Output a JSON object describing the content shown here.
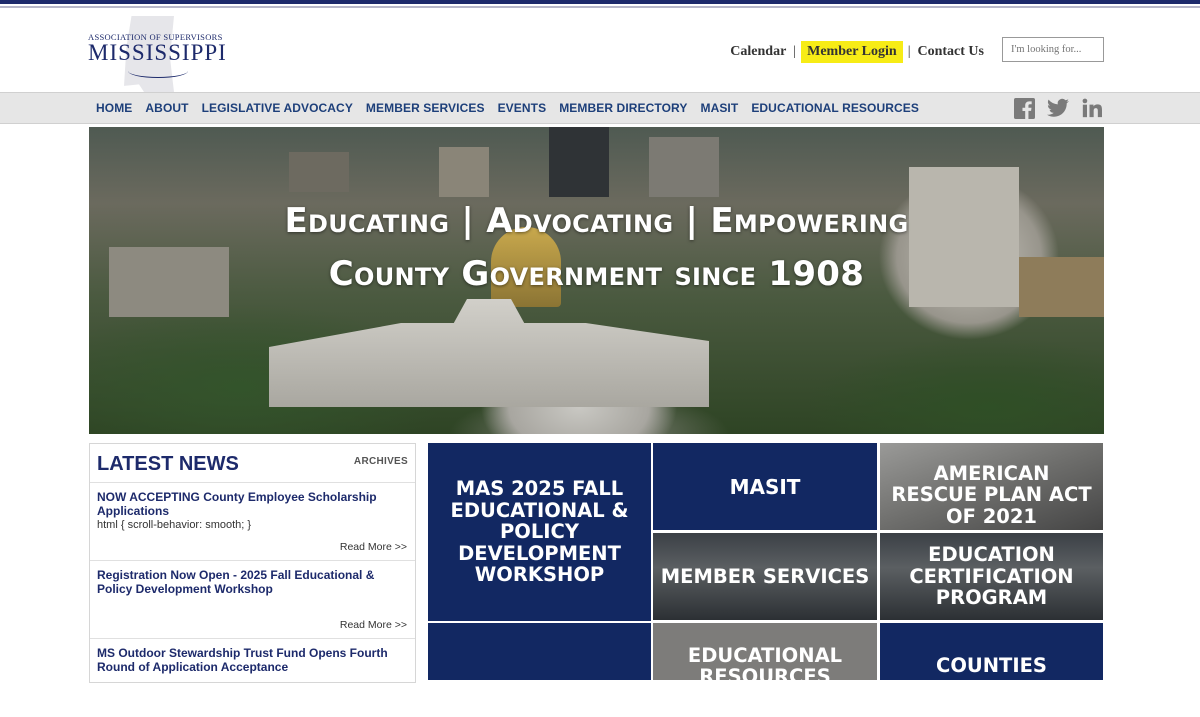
{
  "header": {
    "logo": {
      "assoc_text": "ASSOCIATION OF SUPERVISORS",
      "state_text": "MISSISSIPPI"
    },
    "links": {
      "calendar": "Calendar",
      "sep": "|",
      "member_login": "Member Login",
      "contact": "Contact Us"
    },
    "search_placeholder": "I'm looking for...",
    "highlight_color": "#f7ec16"
  },
  "nav": {
    "items": [
      "HOME",
      "ABOUT",
      "LEGISLATIVE ADVOCACY",
      "MEMBER SERVICES",
      "EVENTS",
      "MEMBER DIRECTORY",
      "MASIT",
      "EDUCATIONAL RESOURCES"
    ],
    "social": [
      "facebook-icon",
      "twitter-icon",
      "linkedin-icon"
    ]
  },
  "hero": {
    "line1": "Educating | Advocating | Empowering",
    "line2": "County Government since 1908"
  },
  "news": {
    "title": "LATEST NEWS",
    "archives": "ARCHIVES",
    "read_more": "Read More >>",
    "items": [
      {
        "title": "NOW ACCEPTING County Employee Scholarship Applications",
        "snippet": "html { scroll-behavior: smooth; }"
      },
      {
        "title": "Registration Now Open - 2025 Fall Educational & Policy Development Workshop",
        "snippet": ""
      },
      {
        "title": "MS Outdoor Stewardship Trust Fund Opens Fourth Round of Application Acceptance",
        "snippet": ""
      }
    ]
  },
  "tiles": {
    "workshop": "MAS 2025 FALL EDUCATIONAL & POLICY DEVELOPMENT WORKSHOP",
    "masit": "MASIT",
    "arpa": "AMERICAN RESCUE PLAN ACT OF 2021",
    "member_services": "MEMBER SERVICES",
    "ecp": "EDUCATION CERTIFICATION PROGRAM",
    "edu_resources": "EDUCATIONAL RESOURCES",
    "counties": "COUNTIES"
  },
  "colors": {
    "navy": "#122862",
    "nav_text": "#1d3f7a"
  }
}
